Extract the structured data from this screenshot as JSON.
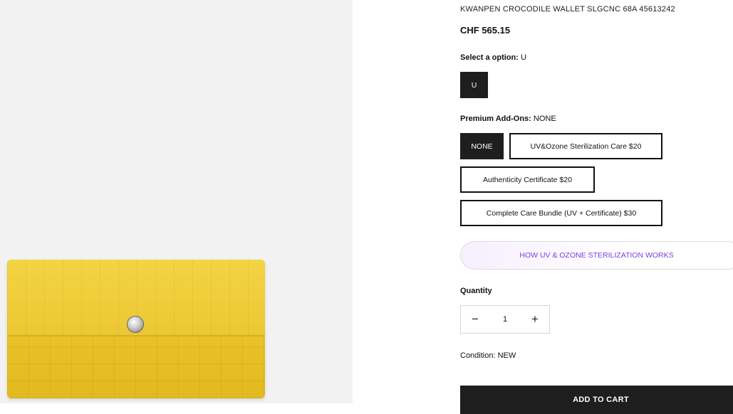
{
  "product": {
    "title": "KWANPEN CROCODILE WALLET SLGCNC 68A 45613242",
    "price": "CHF 565.15"
  },
  "option": {
    "label": "Select a option:",
    "selected_value": "U",
    "choices": [
      "U"
    ]
  },
  "addons": {
    "label": "Premium Add-Ons:",
    "selected_value": "NONE",
    "choices": [
      "NONE",
      "UV&Ozone Sterilization Care $20",
      "Authenticity Certificate $20",
      "Complete Care Bundle (UV + Certificate) $30"
    ]
  },
  "how_link": "HOW UV & OZONE STERILIZATION WORKS",
  "quantity": {
    "label": "Quantity",
    "minus": "−",
    "value": "1",
    "plus": "+"
  },
  "condition": "Condition: NEW",
  "add_to_cart": "ADD TO CART",
  "colors": {
    "selected_bg": "#1e1e1e",
    "link_purple": "#7b3fd9",
    "wallet_yellow": "#ecc733"
  }
}
